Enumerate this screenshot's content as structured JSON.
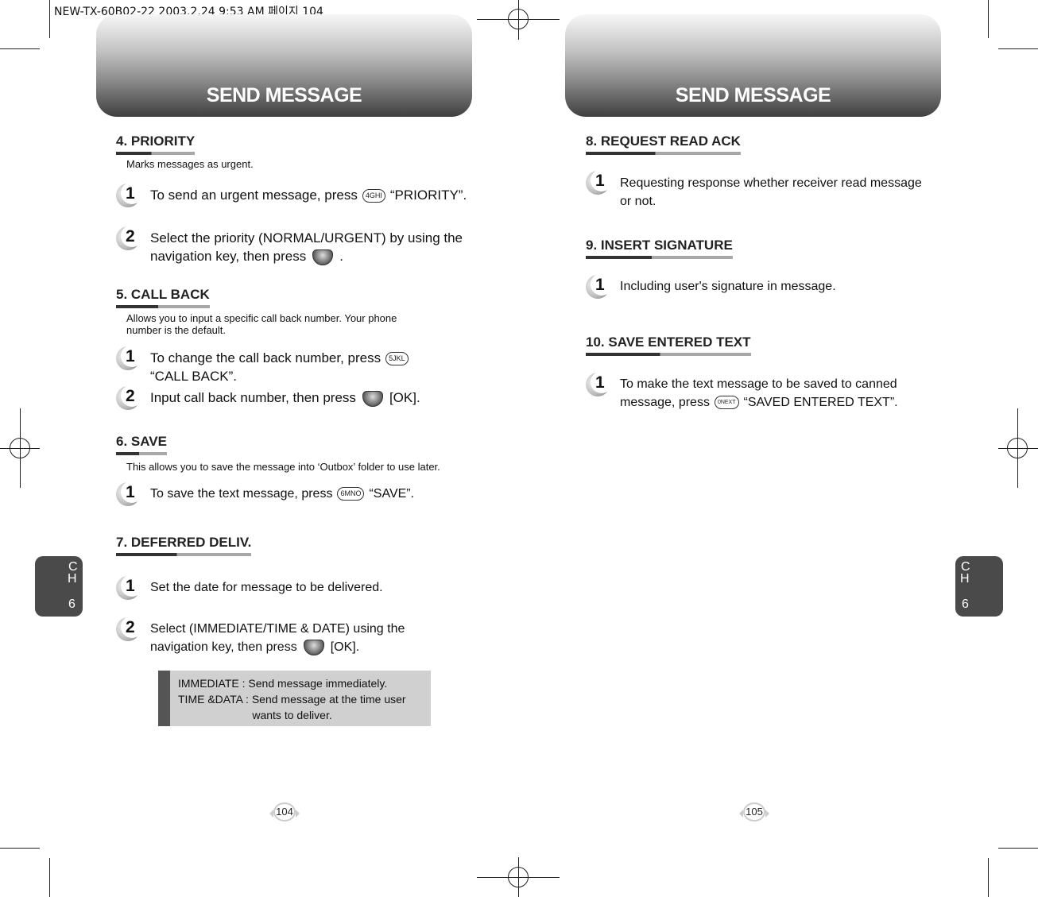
{
  "print_header": "NEW-TX-60B02-22  2003.2.24 9:53 AM  페이지 104",
  "left_page": {
    "banner_title": "SEND MESSAGE",
    "chapter_tab": {
      "c": "C",
      "h": "H",
      "num": "6"
    },
    "page_number": "104",
    "sections": {
      "priority": {
        "title": "4. PRIORITY",
        "desc": "Marks messages as urgent.",
        "steps": [
          {
            "num": "1",
            "before": "To send an urgent message, press",
            "key": "4GHI",
            "after": "“PRIORITY”."
          },
          {
            "num": "2",
            "line1": "Select the priority (NORMAL/URGENT) by using the",
            "line2": "navigation key, then press",
            "after": "."
          }
        ]
      },
      "call_back": {
        "title": "5. CALL BACK",
        "desc_line1": "Allows you to input a specific call back number. Your phone",
        "desc_line2": "number is the default.",
        "steps": [
          {
            "num": "1",
            "before": "To change the call back number, press",
            "key": "5JKL",
            "line2": "“CALL BACK”."
          },
          {
            "num": "2",
            "before": "Input call back number, then press",
            "after": "[OK]."
          }
        ]
      },
      "save": {
        "title": "6. SAVE",
        "desc": "This allows you to save the message into ‘Outbox’ folder to use later.",
        "steps": [
          {
            "num": "1",
            "before": "To save the text message, press",
            "key": "6MNO",
            "after": "“SAVE”."
          }
        ]
      },
      "deferred": {
        "title": "7. DEFERRED DELIV.",
        "steps": [
          {
            "num": "1",
            "text": "Set the date for message to be delivered."
          },
          {
            "num": "2",
            "line1": "Select (IMMEDIATE/TIME & DATE) using the",
            "line2": "navigation key, then press",
            "after": "[OK]."
          }
        ],
        "note": "IMMEDIATE : Send message immediately.\nTIME &DATA : Send message at the time user\n                        wants to deliver."
      }
    }
  },
  "right_page": {
    "banner_title": "SEND MESSAGE",
    "chapter_tab": {
      "c": "C",
      "h": "H",
      "num": "6"
    },
    "page_number": "105",
    "sections": {
      "read_ack": {
        "title": "8. REQUEST READ ACK",
        "steps": [
          {
            "num": "1",
            "line1": "Requesting response whether receiver read message",
            "line2": "or not."
          }
        ]
      },
      "signature": {
        "title": "9. INSERT SIGNATURE",
        "steps": [
          {
            "num": "1",
            "text": "Including user's signature in message."
          }
        ]
      },
      "save_text": {
        "title": "10. SAVE ENTERED TEXT",
        "steps": [
          {
            "num": "1",
            "line1": "To make the text message to be saved to canned",
            "before": "message, press",
            "key": "0NEXT",
            "after": "“SAVED ENTERED TEXT”."
          }
        ]
      }
    }
  }
}
